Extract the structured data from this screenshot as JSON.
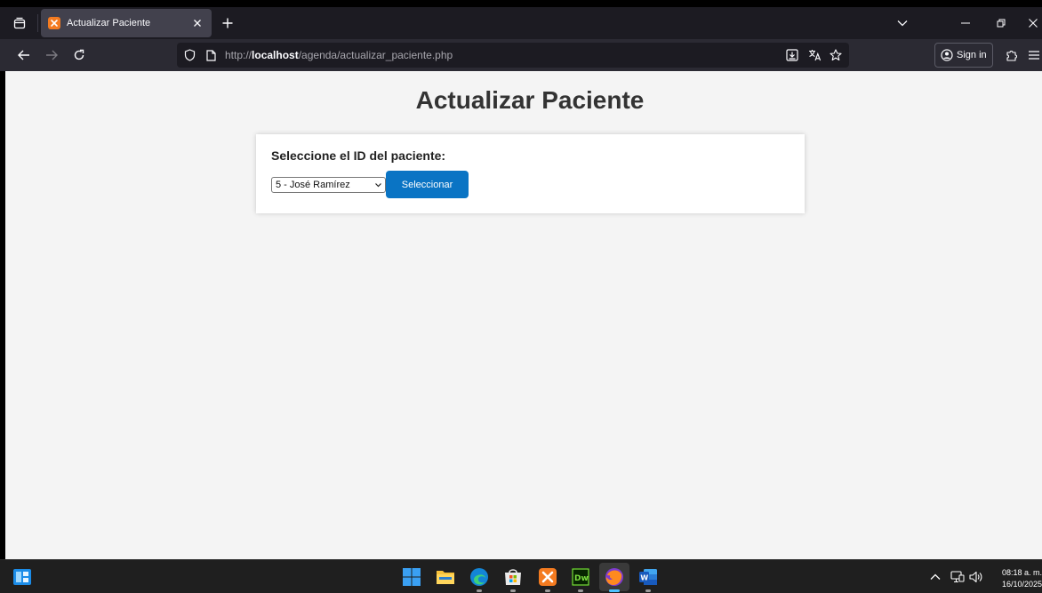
{
  "browser": {
    "tab": {
      "title": "Actualizar Paciente"
    },
    "url": {
      "scheme": "http://",
      "host": "localhost",
      "path": "/agenda/actualizar_paciente.php"
    },
    "signin_label": "Sign in"
  },
  "page": {
    "title": "Actualizar Paciente",
    "form": {
      "label": "Seleccione el ID del paciente:",
      "selected_option": "5 - José Ramírez",
      "submit_label": "Seleccionar"
    }
  },
  "taskbar": {
    "apps": [
      "windows-start",
      "file-explorer",
      "edge",
      "microsoft-store",
      "xampp",
      "dreamweaver",
      "firefox",
      "word"
    ],
    "active_app": "firefox",
    "time": "08:18 a. m.",
    "date": "16/10/2025"
  },
  "colors": {
    "accent_button": "#0a74c4",
    "page_background": "#f4f4f4",
    "tab_strip": "#1c1b22",
    "nav_bar": "#2b2a33"
  }
}
